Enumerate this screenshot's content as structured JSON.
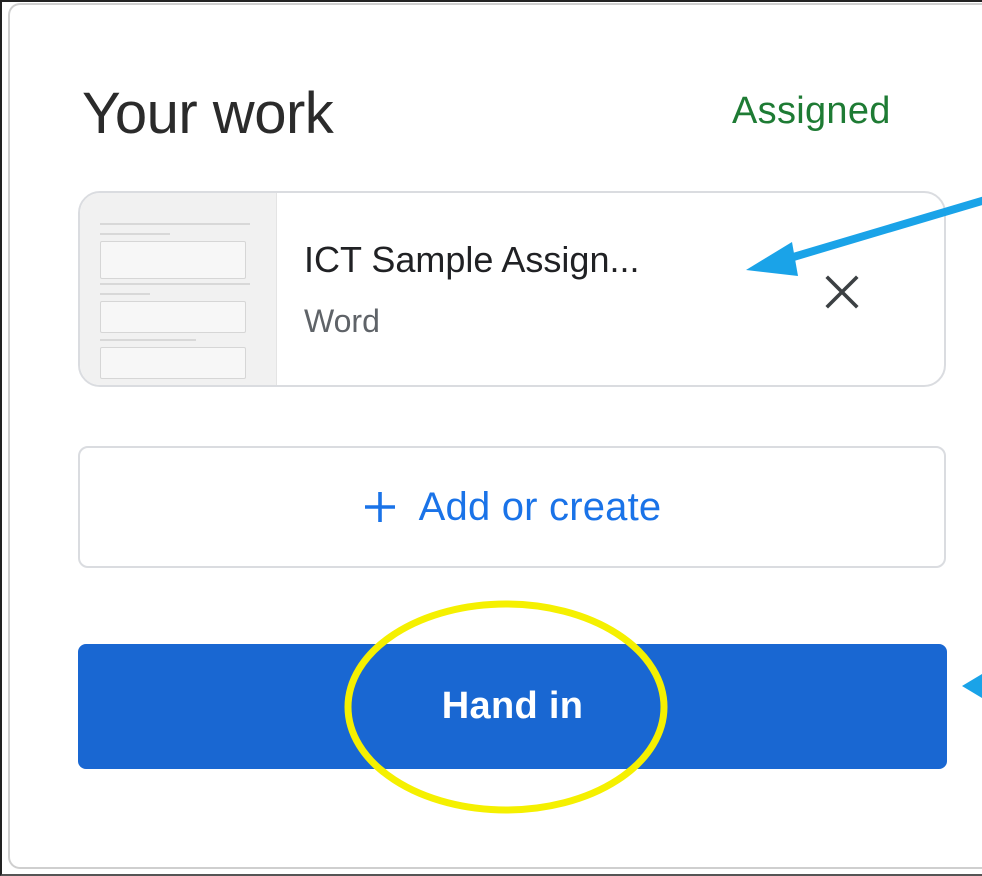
{
  "panel": {
    "title": "Your work",
    "status": "Assigned"
  },
  "attachment": {
    "name": "ICT Sample Assign...",
    "type": "Word",
    "remove_icon": "close-icon"
  },
  "actions": {
    "add_label": "Add or create",
    "add_icon": "plus-icon",
    "hand_in_label": "Hand in"
  },
  "colors": {
    "status_green": "#1e7b34",
    "link_blue": "#1a73e8",
    "button_blue": "#1967d2",
    "annotation_arrow": "#1aa3e8",
    "annotation_circle": "#f5f000"
  }
}
